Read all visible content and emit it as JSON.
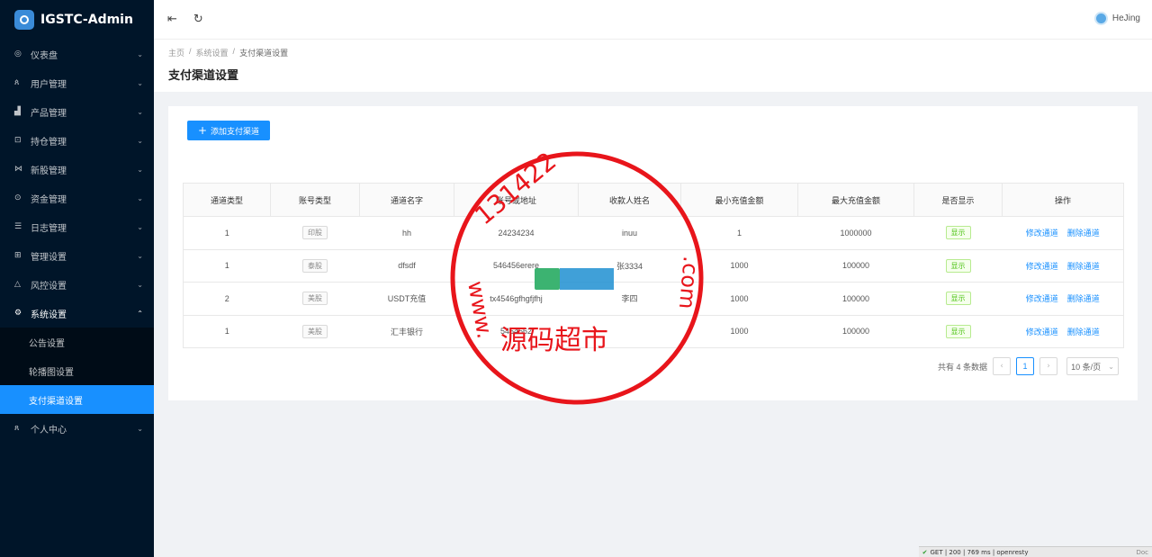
{
  "app": {
    "title": "IGSTC-Admin"
  },
  "sidebar": {
    "items": [
      {
        "label": "仪表盘",
        "icon": "dashboard-icon"
      },
      {
        "label": "用户管理",
        "icon": "users-icon"
      },
      {
        "label": "产品管理",
        "icon": "chart-icon"
      },
      {
        "label": "持仓管理",
        "icon": "position-icon"
      },
      {
        "label": "新股管理",
        "icon": "ipo-icon"
      },
      {
        "label": "资金管理",
        "icon": "money-icon"
      },
      {
        "label": "日志管理",
        "icon": "log-icon"
      },
      {
        "label": "管理设置",
        "icon": "manage-icon"
      },
      {
        "label": "风控设置",
        "icon": "warning-icon"
      },
      {
        "label": "系统设置",
        "icon": "gear-icon"
      }
    ],
    "submenu": [
      {
        "label": "公告设置"
      },
      {
        "label": "轮播图设置"
      },
      {
        "label": "支付渠道设置"
      }
    ],
    "last_item": {
      "label": "个人中心",
      "icon": "user-icon"
    }
  },
  "header": {
    "user_name": "HeJing"
  },
  "breadcrumb": {
    "home": "主页",
    "section": "系统设置",
    "current": "支付渠道设置"
  },
  "page": {
    "title": "支付渠道设置"
  },
  "toolbar": {
    "add_label": "添加支付渠道"
  },
  "table": {
    "columns": [
      "通道类型",
      "账号类型",
      "通道名字",
      "账号或地址",
      "收款人姓名",
      "最小充值金额",
      "最大充值金额",
      "是否显示",
      "操作"
    ],
    "rows": [
      {
        "type": "1",
        "account_type": "印股",
        "name": "hh",
        "account": "24234234",
        "payee": "inuu",
        "min": "1",
        "max": "1000000",
        "show": "显示"
      },
      {
        "type": "1",
        "account_type": "泰股",
        "name": "dfsdf",
        "account": "546456erere",
        "payee": "张3334",
        "min": "1000",
        "max": "100000",
        "show": "显示"
      },
      {
        "type": "2",
        "account_type": "美股",
        "name": "USDT充值",
        "account": "tx4546gfhgfjfhj",
        "payee": "李四",
        "min": "1000",
        "max": "100000",
        "show": "显示"
      },
      {
        "type": "1",
        "account_type": "美股",
        "name": "汇丰银行",
        "account": "5464562",
        "payee": "",
        "min": "1000",
        "max": "100000",
        "show": "显示"
      }
    ],
    "op_edit": "修改通道",
    "op_delete": "删除通道"
  },
  "pagination": {
    "total_text": "共有 4 条数据",
    "current_page": "1",
    "page_size": "10 条/页"
  },
  "watermark": {
    "text_top": "131422",
    "text_side": "www.",
    "text_right": ".com",
    "text_bottom": "源码超市",
    "color": "#e8151b"
  },
  "status_bar": {
    "text": "GET | 200 | 769 ms | openresty",
    "doc": "Doc"
  },
  "colors": {
    "sidebar_bg": "#001529",
    "primary": "#1890ff",
    "success": "#52c41a"
  }
}
